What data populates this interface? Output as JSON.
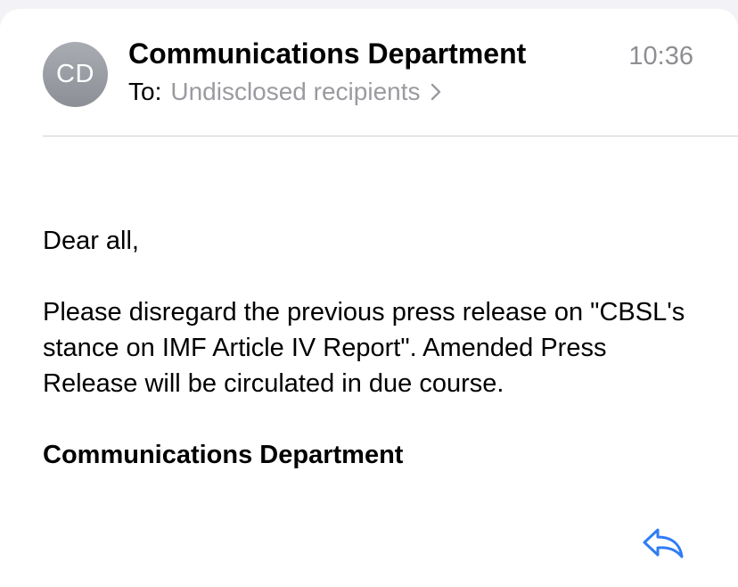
{
  "header": {
    "avatar_initials": "CD",
    "sender": "Communications Department",
    "time": "10:36",
    "to_label": "To:",
    "recipients": "Undisclosed recipients"
  },
  "message": {
    "greeting": "Dear all,",
    "paragraph": "Please disregard the previous press release on \"CBSL's stance on IMF Article IV Report\". Amended Press Release will be circulated in due course.",
    "signature": "Communications Department"
  },
  "icons": {
    "recipients_chevron": "chevron-right-icon",
    "reply": "reply-icon"
  },
  "colors": {
    "accent": "#2f7cf6",
    "avatar": "#9a9da4",
    "secondary_text": "#8e8e93"
  }
}
